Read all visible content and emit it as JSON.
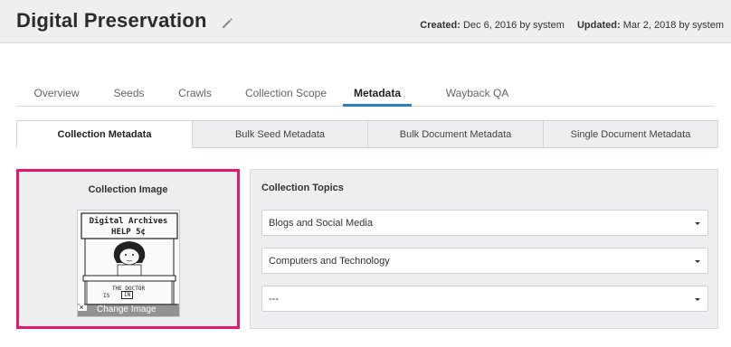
{
  "header": {
    "title": "Digital Preservation",
    "created_label": "Created:",
    "created_value": "Dec 6, 2016 by system",
    "updated_label": "Updated:",
    "updated_value": "Mar 2, 2018 by system"
  },
  "tabs": [
    {
      "label": "Overview"
    },
    {
      "label": "Seeds"
    },
    {
      "label": "Crawls"
    },
    {
      "label": "Collection Scope"
    },
    {
      "label": "Metadata",
      "active": true
    },
    {
      "label": "Wayback QA"
    }
  ],
  "subtabs": [
    {
      "label": "Collection Metadata",
      "active": true
    },
    {
      "label": "Bulk Seed Metadata"
    },
    {
      "label": "Bulk Document Metadata"
    },
    {
      "label": "Single Document Metadata"
    }
  ],
  "collection_image": {
    "title": "Collection Image",
    "thumbnail_text_line1": "Digital Archives",
    "thumbnail_text_line2": "HELP 5¢",
    "thumbnail_sign": "THE DOCTOR",
    "thumbnail_is": "IS",
    "thumbnail_in": "IN",
    "change_label": "Change Image",
    "highlight_color": "#e5176f"
  },
  "collection_topics": {
    "title": "Collection Topics",
    "selects": [
      {
        "value": "Blogs and Social Media"
      },
      {
        "value": "Computers and Technology"
      },
      {
        "value": "---"
      }
    ]
  },
  "colors": {
    "active_tab_underline": "#2a7fc0",
    "header_bg": "#eeeff0",
    "panel_bg": "#eceeef"
  },
  "icons": {
    "edit": "pencil-icon",
    "camera": "camera-icon",
    "remove": "close-circle-icon",
    "dropdown": "caret-down-icon"
  }
}
